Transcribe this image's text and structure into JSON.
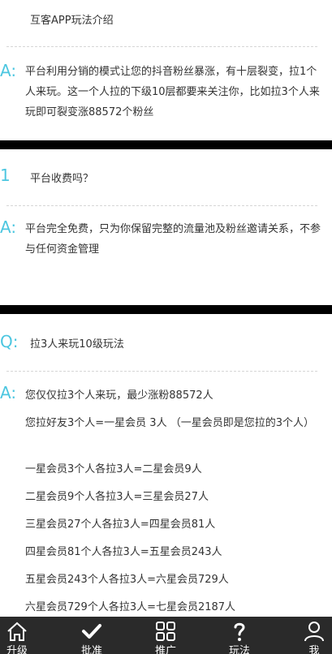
{
  "intro": {
    "title": "互客APP玩法介绍",
    "answer_marker": "A:",
    "answer": "平台利用分销的模式让您的抖音粉丝暴涨，有十层裂变，拉1个人来玩。这一个人拉的下级10层都要来关注你，比如拉3个人来玩即可裂变涨88572个粉丝"
  },
  "faq1": {
    "marker": "1",
    "question": "平台收费吗？",
    "answer_marker": "A:",
    "answer": "平台完全免费，只为你保留完整的流量池及粉丝邀请关系，不参与任何资金管理"
  },
  "faq2": {
    "marker": "Q:",
    "question": "拉3人来玩10级玩法",
    "answer_marker": "A:",
    "lines": [
      "您仅仅拉3个人来玩，最少涨粉88572人",
      "您拉好友3个人=一星会员 3人 （一星会员即是您拉的3个人）",
      "一星会员3个人各拉3人=二星会员9人",
      "二星会员9个人各拉3人=三星会员27人",
      "三星会员27个人各拉3人=四星会员81人",
      "四星会员81个人各拉3人=五星会员243人",
      "五星会员243个人各拉3人=六星会员729人",
      "六星会员729个人各拉3人=七星会员2187人"
    ]
  },
  "tabbar": {
    "items": [
      {
        "label": "升级",
        "icon": "home-icon"
      },
      {
        "label": "批准",
        "icon": "check-icon"
      },
      {
        "label": "推广",
        "icon": "grid-icon"
      },
      {
        "label": "玩法",
        "icon": "question-icon"
      },
      {
        "label": "我",
        "icon": "user-icon"
      }
    ]
  },
  "colors": {
    "accent": "#4cc6e0",
    "bar": "#000000",
    "tabbar_bg": "#2a2a2a"
  }
}
